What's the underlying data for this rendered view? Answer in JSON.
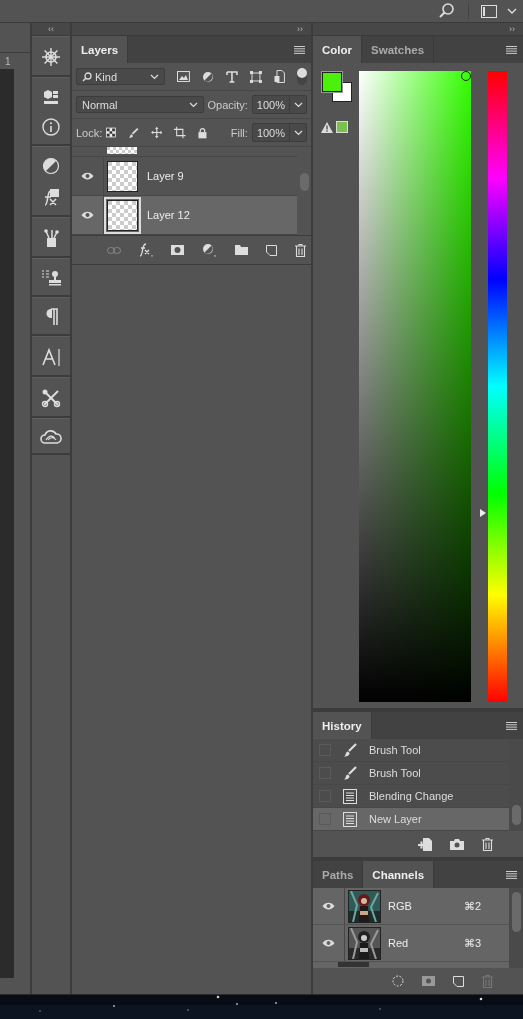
{
  "ruler": {
    "label": "1"
  },
  "collapse_marks": {
    "tool_strip": "‹‹",
    "layers_panel": "››",
    "side_panel": "››"
  },
  "layers": {
    "tab": "Layers",
    "filter": "Kind",
    "blend_mode": "Normal",
    "opacity_label": "Opacity:",
    "opacity": "100%",
    "lock_label": "Lock:",
    "fill_label": "Fill:",
    "fill": "100%",
    "items": [
      {
        "name": "Layer 9",
        "visible": true,
        "selected": false
      },
      {
        "name": "Layer 12",
        "visible": true,
        "selected": true
      }
    ]
  },
  "color": {
    "tabs": [
      {
        "label": "Color",
        "selected": true
      },
      {
        "label": "Swatches",
        "selected": false
      }
    ],
    "hue": {
      "level": 0.3
    }
  },
  "history": {
    "tab": "History",
    "items": [
      {
        "label": "Brush Tool",
        "kind": "brush",
        "selected": false
      },
      {
        "label": "Brush Tool",
        "kind": "brush",
        "selected": false
      },
      {
        "label": "Blending Change",
        "kind": "document",
        "selected": false
      },
      {
        "label": "New Layer",
        "kind": "document",
        "selected": true
      }
    ]
  },
  "channels": {
    "tabs": [
      {
        "label": "Paths",
        "selected": false
      },
      {
        "label": "Channels",
        "selected": true
      }
    ],
    "items": [
      {
        "name": "RGB",
        "shortcut": "⌘2",
        "visible": true,
        "kind": "color"
      },
      {
        "name": "Red",
        "shortcut": "⌘3",
        "visible": true,
        "kind": "gray"
      }
    ]
  }
}
